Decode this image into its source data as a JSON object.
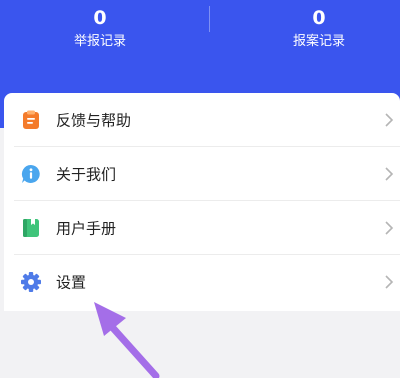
{
  "header": {
    "stats": [
      {
        "value": "0",
        "label": "举报记录"
      },
      {
        "value": "0",
        "label": "报案记录"
      }
    ],
    "color": "#3a55ee"
  },
  "menu": {
    "items": [
      {
        "label": "反馈与帮助",
        "icon": "clipboard-icon",
        "icon_color": "#f47b2a"
      },
      {
        "label": "关于我们",
        "icon": "info-bubble-icon",
        "icon_color": "#4aa6ee"
      },
      {
        "label": "用户手册",
        "icon": "book-icon",
        "icon_color": "#3fc47a"
      },
      {
        "label": "设置",
        "icon": "gear-icon",
        "icon_color": "#4f7be8"
      }
    ]
  },
  "annotation": {
    "icon": "pointer-arrow-icon",
    "color": "#a46ee8"
  }
}
